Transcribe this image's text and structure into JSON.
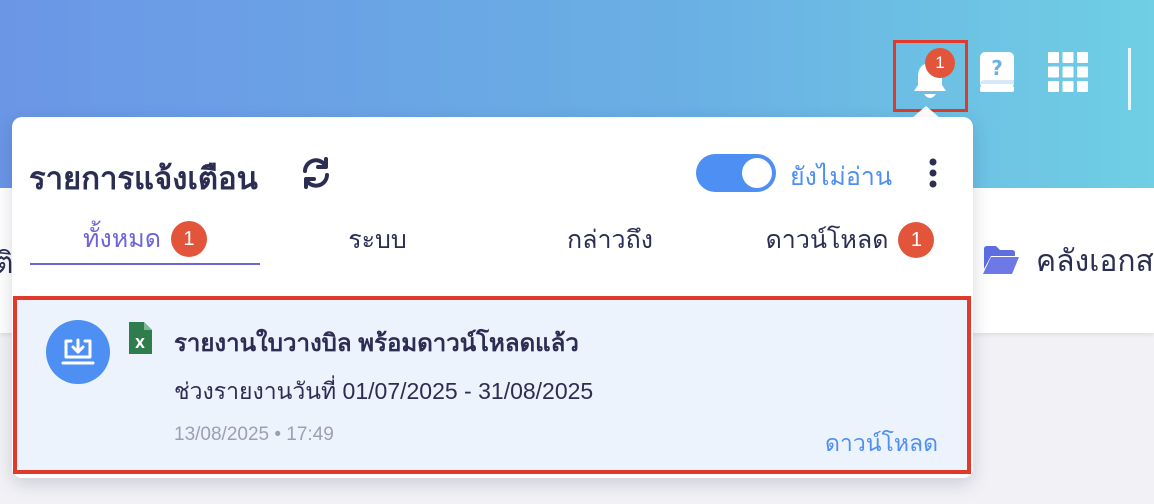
{
  "header": {
    "notification_badge": "1",
    "icons": [
      "bell-icon",
      "help-book-icon",
      "app-grid-icon"
    ],
    "accent": "#e03a2a"
  },
  "background": {
    "left_text": "ติ",
    "archive_label": "คลังเอกส"
  },
  "popup": {
    "title": "รายการแจ้งเตือน",
    "unread_toggle": {
      "label": "ยังไม่อ่าน",
      "on": true,
      "color": "#4d8ff3"
    },
    "tabs": [
      {
        "label": "ทั้งหมด",
        "badge": "1",
        "active": true
      },
      {
        "label": "ระบบ"
      },
      {
        "label": "กล่าวถึง"
      },
      {
        "label": "ดาวน์โหลด",
        "badge": "1"
      }
    ],
    "notification": {
      "title": "รายงานใบวางบิล พร้อมดาวน์โหลดแล้ว",
      "body": "ช่วงรายงานวันที่ 01/07/2025 - 31/08/2025",
      "time": "13/08/2025 • 17:49",
      "action": "ดาวน์โหลด",
      "file_icon": "excel-icon"
    }
  }
}
